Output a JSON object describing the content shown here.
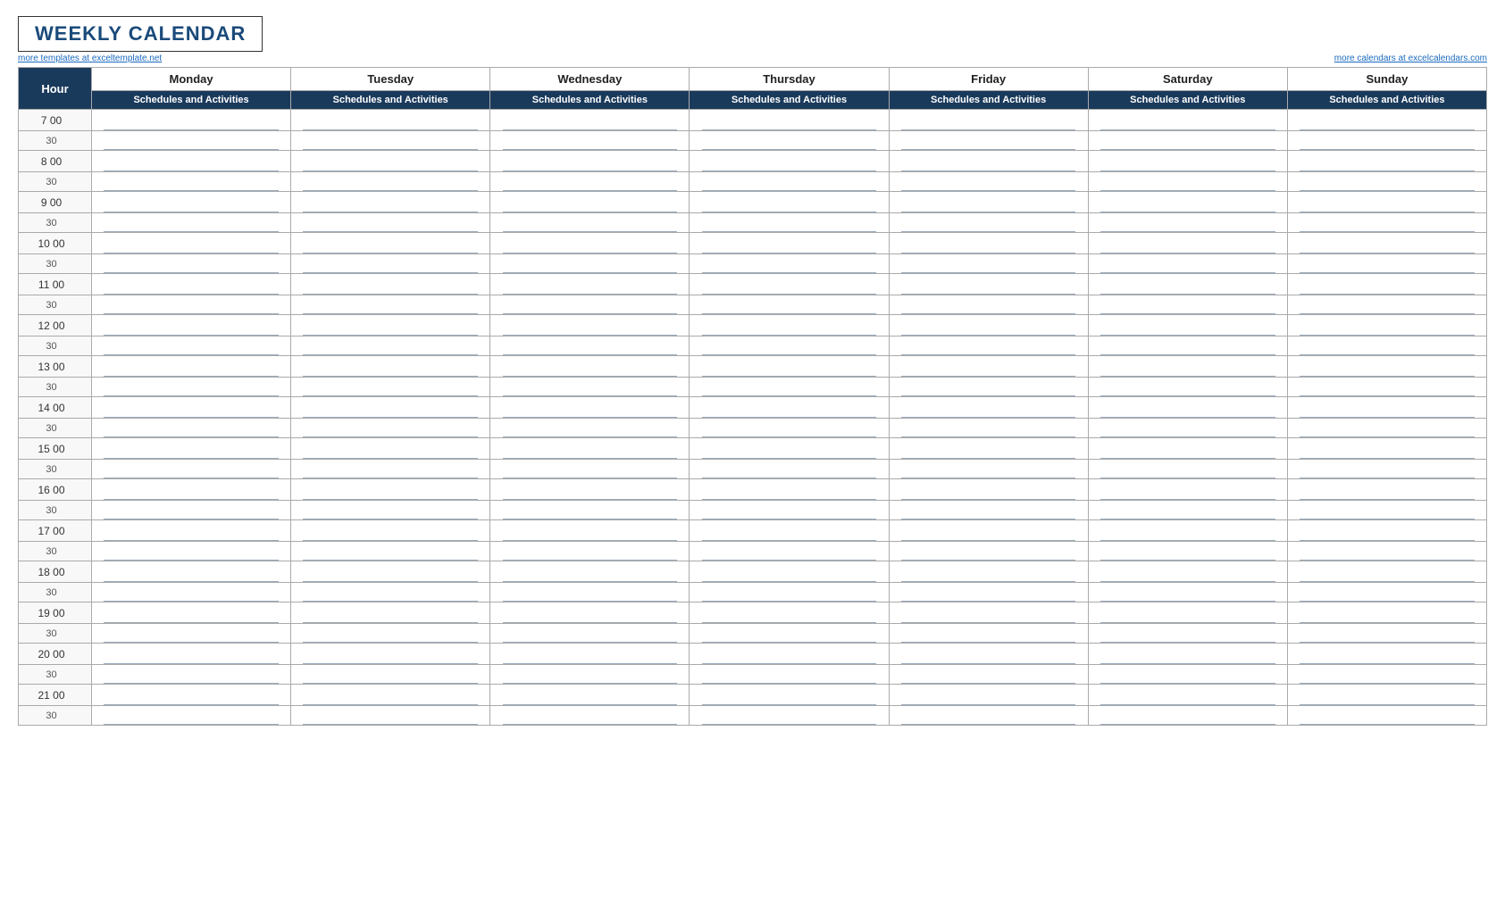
{
  "title": "WEEKLY CALENDAR",
  "link_left": "more templates at exceltemplate.net",
  "link_right": "more calendars at excelcalendars.com",
  "header": {
    "hour_label": "Hour",
    "days": [
      "Monday",
      "Tuesday",
      "Wednesday",
      "Thursday",
      "Friday",
      "Saturday",
      "Sunday"
    ],
    "sub_label": "Schedules and Activities"
  },
  "hours": [
    {
      "hour": "7",
      "label": "7  00",
      "half_label": "30"
    },
    {
      "hour": "8",
      "label": "8  00",
      "half_label": "30"
    },
    {
      "hour": "9",
      "label": "9  00",
      "half_label": "30"
    },
    {
      "hour": "10",
      "label": "10  00",
      "half_label": "30"
    },
    {
      "hour": "11",
      "label": "11  00",
      "half_label": "30"
    },
    {
      "hour": "12",
      "label": "12  00",
      "half_label": "30"
    },
    {
      "hour": "13",
      "label": "13  00",
      "half_label": "30"
    },
    {
      "hour": "14",
      "label": "14  00",
      "half_label": "30"
    },
    {
      "hour": "15",
      "label": "15  00",
      "half_label": "30"
    },
    {
      "hour": "16",
      "label": "16  00",
      "half_label": "30"
    },
    {
      "hour": "17",
      "label": "17  00",
      "half_label": "30"
    },
    {
      "hour": "18",
      "label": "18  00",
      "half_label": "30"
    },
    {
      "hour": "19",
      "label": "19  00",
      "half_label": "30"
    },
    {
      "hour": "20",
      "label": "20  00",
      "half_label": "30"
    },
    {
      "hour": "21",
      "label": "21  00",
      "half_label": "30"
    }
  ]
}
